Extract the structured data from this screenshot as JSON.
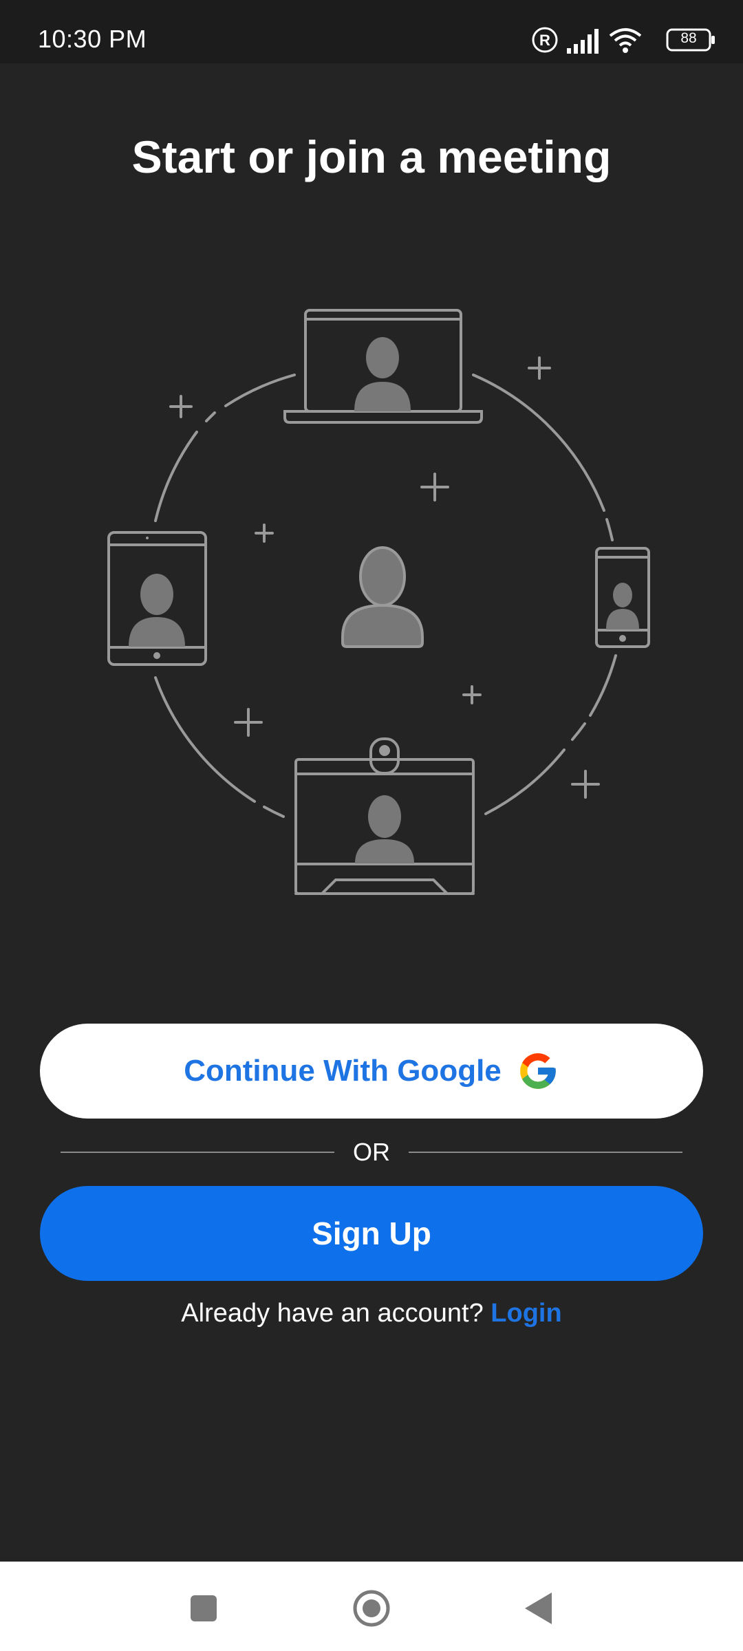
{
  "status_bar": {
    "time": "10:30 PM",
    "battery": "88",
    "icons": [
      "registered-icon",
      "signal-icon",
      "wifi-icon",
      "battery-icon"
    ]
  },
  "main": {
    "title": "Start or join a meeting",
    "google_button_label": "Continue With Google",
    "or_label": "OR",
    "signup_label": "Sign Up",
    "account_prompt": "Already have an account?",
    "login_label": "Login"
  },
  "colors": {
    "background": "#242424",
    "accent": "#0e71eb",
    "link": "#1f74e3"
  },
  "nav_bar": {
    "buttons": [
      "recents-square-icon",
      "home-circle-icon",
      "back-triangle-icon"
    ]
  }
}
